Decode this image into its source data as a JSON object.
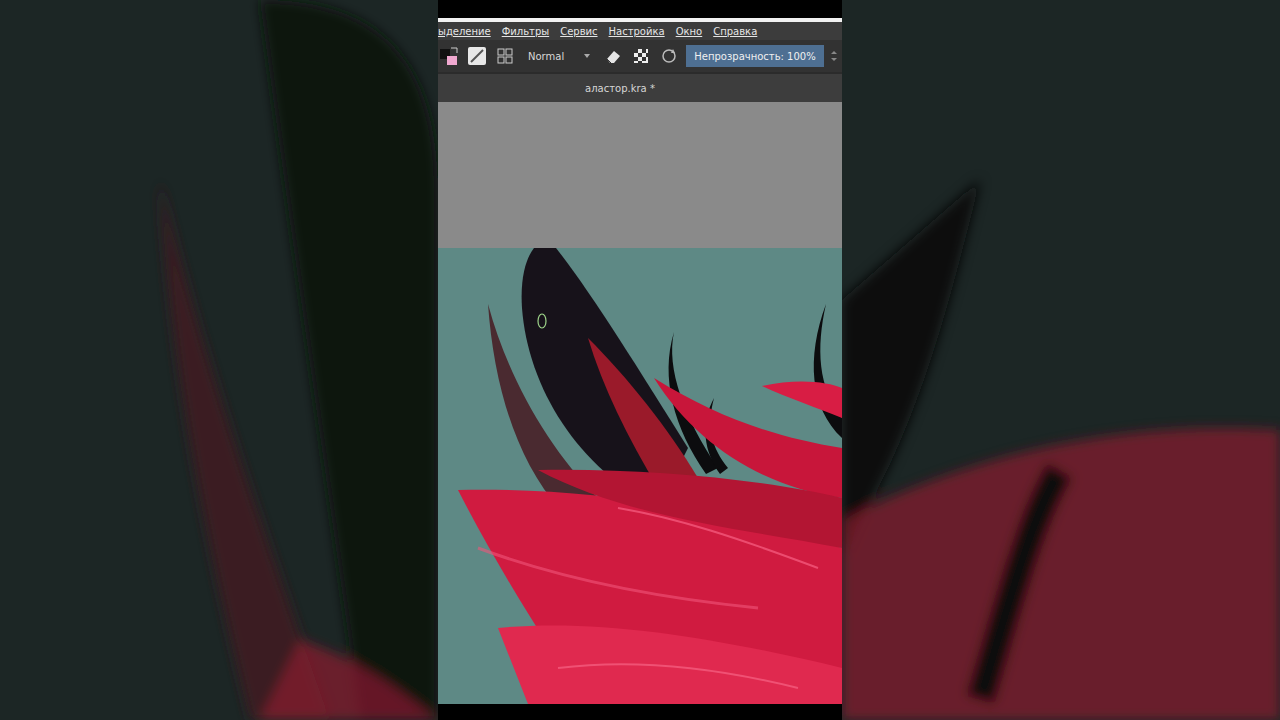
{
  "menu": {
    "items": [
      "ыделение",
      "Фильтры",
      "Сервис",
      "Настройка",
      "Окно",
      "Справка"
    ]
  },
  "toolbar": {
    "blend_mode": "Normal",
    "opacity": {
      "label": "Непрозрачность: 100%",
      "level": 1
    }
  },
  "document_tab": {
    "title": "аластор.kra *"
  }
}
